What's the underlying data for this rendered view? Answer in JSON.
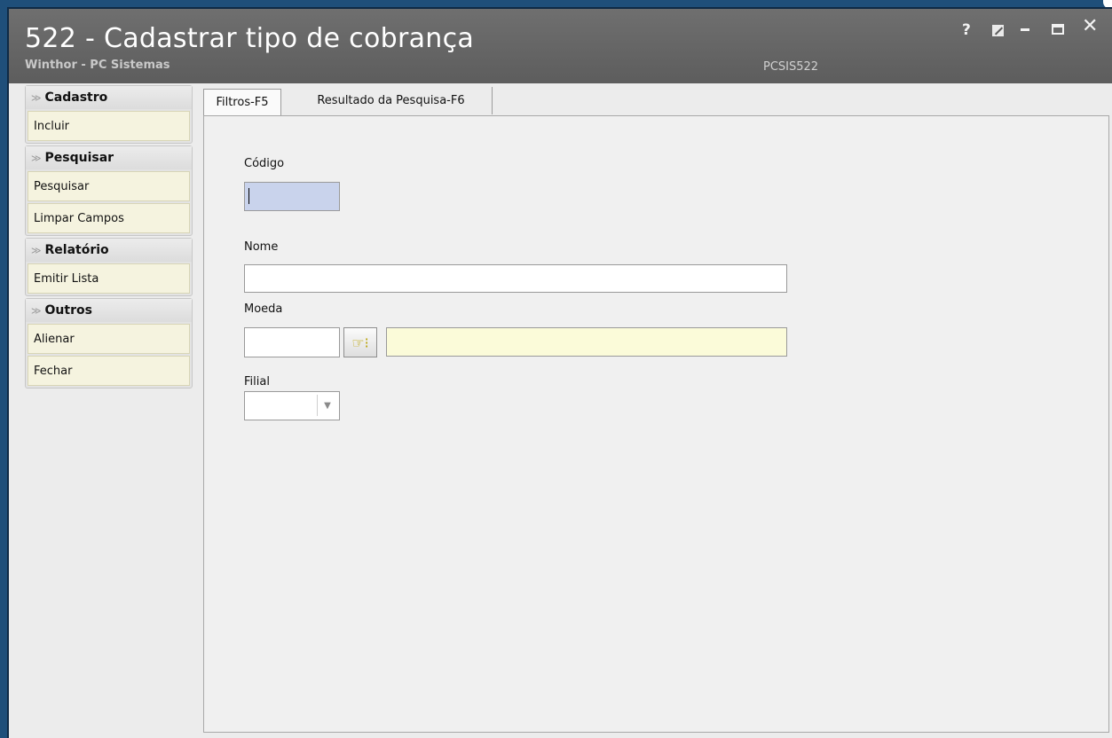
{
  "window": {
    "title": "522 - Cadastrar tipo de cobrança",
    "subtitle": "Winthor - PC Sistemas",
    "code": "PCSIS522",
    "help": "?",
    "close": "✕"
  },
  "sidebar": {
    "sections": [
      {
        "header": "Cadastro",
        "items": [
          "Incluir"
        ]
      },
      {
        "header": "Pesquisar",
        "items": [
          "Pesquisar",
          "Limpar Campos"
        ]
      },
      {
        "header": "Relatório",
        "items": [
          "Emitir Lista"
        ]
      },
      {
        "header": "Outros",
        "items": [
          "Alienar",
          "Fechar"
        ]
      }
    ]
  },
  "tabs": [
    {
      "label": "Filtros-F5",
      "active": true
    },
    {
      "label": "Resultado da Pesquisa-F6",
      "active": false
    }
  ],
  "form": {
    "codigo_label": "Código",
    "codigo_value": "",
    "nome_label": "Nome",
    "nome_value": "",
    "moeda_label": "Moeda",
    "moeda_code_value": "",
    "moeda_desc_value": "",
    "filial_label": "Filial",
    "filial_value": ""
  },
  "colors": {
    "titlebar": "#5d5d5d",
    "code_field": "#c9d3ec",
    "desc_field": "#fbfbd9",
    "sidebar_button": "#f5f3df"
  }
}
